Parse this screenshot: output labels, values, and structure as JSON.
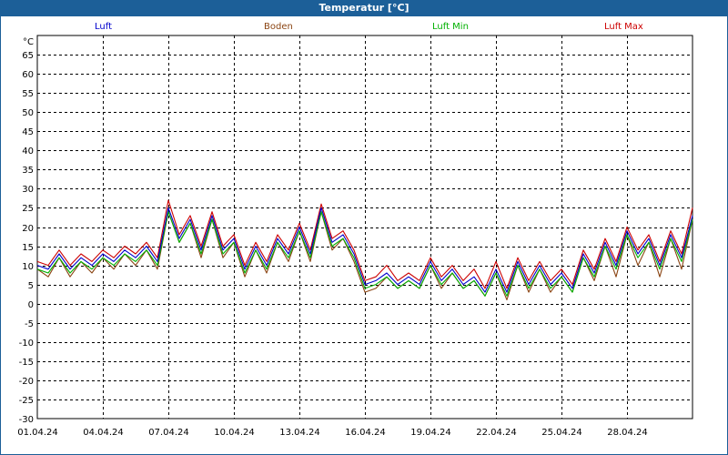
{
  "window": {
    "title": "Temperatur [°C]"
  },
  "chart_data": {
    "type": "line",
    "title": "Temperatur [°C]",
    "ylabel": "°C",
    "xlabel": "",
    "ylim": [
      -30,
      70
    ],
    "yticks": [
      65,
      60,
      55,
      50,
      45,
      40,
      35,
      30,
      25,
      20,
      15,
      10,
      5,
      0,
      -5,
      -10,
      -15,
      -20,
      -25,
      -30
    ],
    "xlim": [
      "01.04.24 00:00",
      "01.05.24 00:00"
    ],
    "xticks": [
      "01.04.24",
      "04.04.24",
      "07.04.24",
      "10.04.24",
      "13.04.24",
      "16.04.24",
      "19.04.24",
      "22.04.24",
      "25.04.24",
      "28.04.24"
    ],
    "grid": true,
    "legend_position": "top",
    "x": [
      "01.04.24 00:00",
      "01.04.24 12:00",
      "02.04.24 00:00",
      "02.04.24 12:00",
      "03.04.24 00:00",
      "03.04.24 12:00",
      "04.04.24 00:00",
      "04.04.24 12:00",
      "05.04.24 00:00",
      "05.04.24 12:00",
      "06.04.24 00:00",
      "06.04.24 12:00",
      "07.04.24 00:00",
      "07.04.24 12:00",
      "08.04.24 00:00",
      "08.04.24 12:00",
      "09.04.24 00:00",
      "09.04.24 12:00",
      "10.04.24 00:00",
      "10.04.24 12:00",
      "11.04.24 00:00",
      "11.04.24 12:00",
      "12.04.24 00:00",
      "12.04.24 12:00",
      "13.04.24 00:00",
      "13.04.24 12:00",
      "14.04.24 00:00",
      "14.04.24 12:00",
      "15.04.24 00:00",
      "15.04.24 12:00",
      "16.04.24 00:00",
      "16.04.24 12:00",
      "17.04.24 00:00",
      "17.04.24 12:00",
      "18.04.24 00:00",
      "18.04.24 12:00",
      "19.04.24 00:00",
      "19.04.24 12:00",
      "20.04.24 00:00",
      "20.04.24 12:00",
      "21.04.24 00:00",
      "21.04.24 12:00",
      "22.04.24 00:00",
      "22.04.24 12:00",
      "23.04.24 00:00",
      "23.04.24 12:00",
      "24.04.24 00:00",
      "24.04.24 12:00",
      "25.04.24 00:00",
      "25.04.24 12:00",
      "26.04.24 00:00",
      "26.04.24 12:00",
      "27.04.24 00:00",
      "27.04.24 12:00",
      "28.04.24 00:00",
      "28.04.24 12:00",
      "29.04.24 00:00",
      "29.04.24 12:00",
      "30.04.24 00:00",
      "30.04.24 12:00",
      "01.05.24 00:00"
    ],
    "series": [
      {
        "name": "Luft",
        "color": "#0000cc",
        "values": [
          10,
          9,
          13,
          9,
          12,
          10,
          13,
          11,
          14,
          12,
          15,
          11,
          25,
          17,
          22,
          14,
          23,
          14,
          17,
          9,
          15,
          10,
          17,
          13,
          20,
          13,
          25,
          16,
          18,
          13,
          5,
          6,
          8,
          5,
          7,
          5,
          11,
          6,
          9,
          5,
          7,
          3,
          9,
          3,
          11,
          5,
          10,
          5,
          8,
          4,
          13,
          8,
          16,
          10,
          19,
          13,
          17,
          10,
          18,
          12,
          23
        ]
      },
      {
        "name": "Boden",
        "color": "#8b4513",
        "values": [
          9,
          7,
          12,
          7,
          11,
          8,
          12,
          9,
          13,
          10,
          14,
          9,
          24,
          16,
          21,
          12,
          22,
          12,
          16,
          7,
          14,
          8,
          16,
          11,
          19,
          11,
          24,
          14,
          17,
          11,
          3,
          4,
          7,
          4,
          6,
          4,
          10,
          4,
          8,
          4,
          6,
          2,
          8,
          1,
          10,
          3,
          9,
          3,
          7,
          3,
          12,
          6,
          15,
          7,
          18,
          10,
          16,
          7,
          17,
          9,
          22
        ]
      },
      {
        "name": "Luft Min",
        "color": "#00b000",
        "values": [
          9,
          8,
          12,
          8,
          11,
          9,
          12,
          10,
          13,
          11,
          14,
          10,
          24,
          16,
          21,
          13,
          22,
          13,
          16,
          8,
          14,
          9,
          16,
          12,
          19,
          12,
          24,
          15,
          17,
          12,
          4,
          5,
          7,
          4,
          6,
          4,
          10,
          5,
          8,
          4,
          6,
          2,
          8,
          2,
          10,
          4,
          9,
          4,
          7,
          3,
          12,
          7,
          15,
          9,
          18,
          12,
          16,
          9,
          17,
          11,
          22
        ]
      },
      {
        "name": "Luft Max",
        "color": "#cc0000",
        "values": [
          11,
          10,
          14,
          10,
          13,
          11,
          14,
          12,
          15,
          13,
          16,
          12,
          27,
          18,
          23,
          15,
          24,
          15,
          18,
          10,
          16,
          11,
          18,
          14,
          21,
          14,
          26,
          17,
          19,
          14,
          6,
          7,
          10,
          6,
          8,
          6,
          12,
          7,
          10,
          6,
          9,
          4,
          11,
          4,
          12,
          6,
          11,
          6,
          9,
          5,
          14,
          9,
          17,
          11,
          20,
          14,
          18,
          11,
          19,
          13,
          25
        ]
      }
    ]
  }
}
